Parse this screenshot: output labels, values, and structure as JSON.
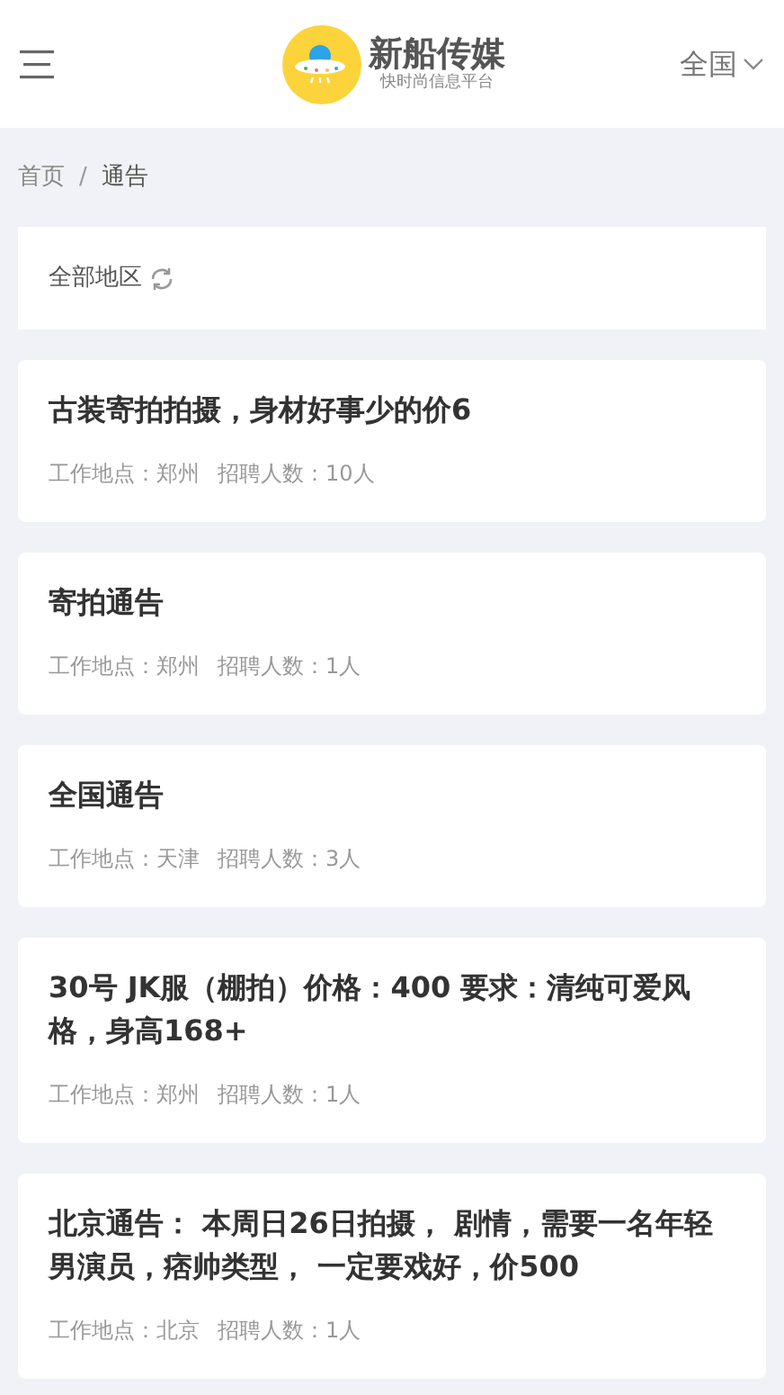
{
  "header": {
    "brand": "新船传媒",
    "slogan": "快时尚信息平台",
    "region": "全国"
  },
  "breadcrumb": {
    "items": [
      "首页",
      "通告"
    ],
    "separator": "/"
  },
  "filter": {
    "label": "全部地区"
  },
  "notices": [
    {
      "title": "古装寄拍拍摄，身材好事少的价6",
      "location": "工作地点：郑州",
      "headcount": "招聘人数：10人"
    },
    {
      "title": "寄拍通告",
      "location": "工作地点：郑州",
      "headcount": "招聘人数：1人"
    },
    {
      "title": "全国通告",
      "location": "工作地点：天津",
      "headcount": "招聘人数：3人"
    },
    {
      "title": "30号 JK服（棚拍）价格：400 要求：清纯可爱风格，身高168+",
      "location": "工作地点：郑州",
      "headcount": "招聘人数：1人"
    },
    {
      "title": "北京通告： 本周日26日拍摄， 剧情，需要一名年轻男演员，痞帅类型， 一定要戏好，价500",
      "location": "工作地点：北京",
      "headcount": "招聘人数：1人"
    }
  ]
}
